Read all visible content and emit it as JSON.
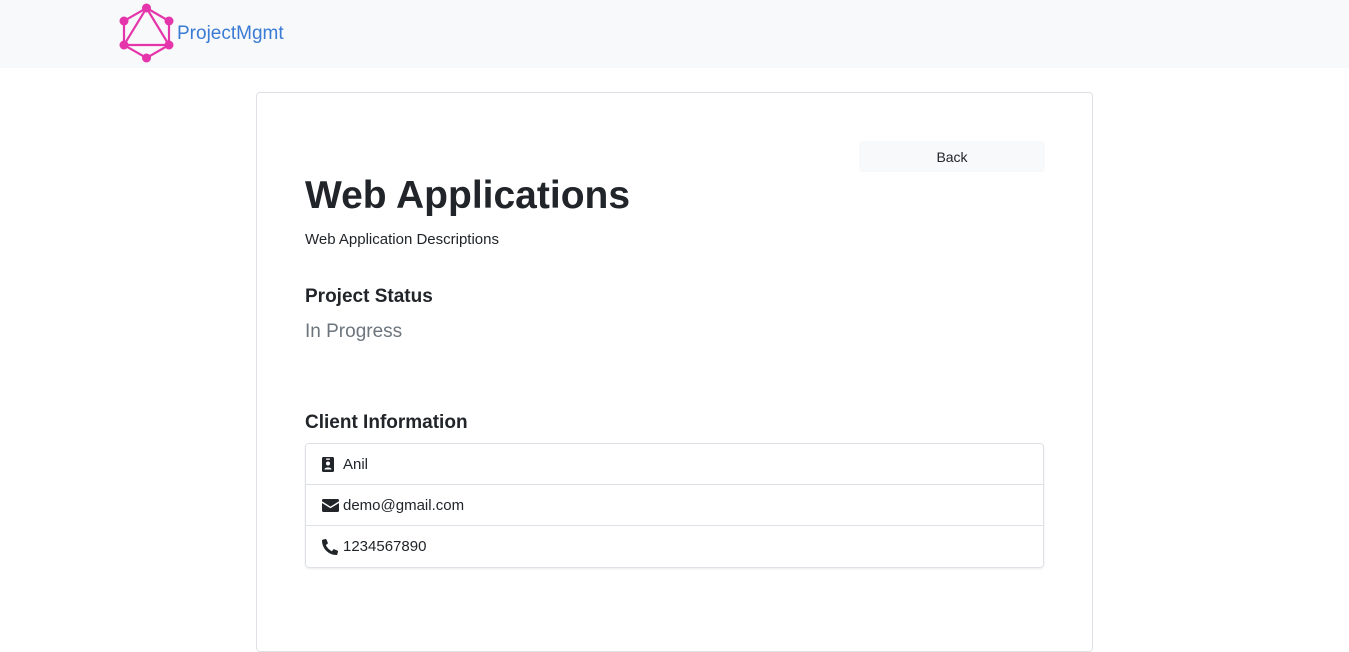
{
  "brand": {
    "name": "ProjectMgmt",
    "logo_icon": "graphql-logo-icon",
    "logo_color": "#e535ab",
    "text_color": "#3a7bd5"
  },
  "project": {
    "back_label": "Back",
    "title": "Web Applications",
    "description": "Web Application Descriptions",
    "status_heading": "Project Status",
    "status_value": "In Progress"
  },
  "client": {
    "heading": "Client Information",
    "items": [
      {
        "icon": "id-badge-icon",
        "value": "Anil"
      },
      {
        "icon": "envelope-icon",
        "value": "demo@gmail.com"
      },
      {
        "icon": "phone-icon",
        "value": "1234567890"
      }
    ]
  }
}
